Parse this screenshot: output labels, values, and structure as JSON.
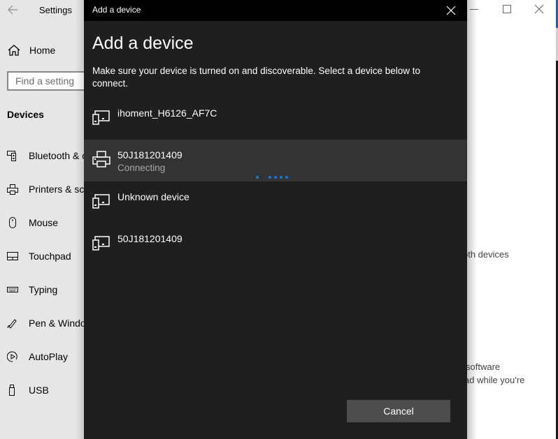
{
  "settings_window": {
    "title": "Settings",
    "home_label": "Home",
    "search_placeholder": "Find a setting",
    "section_heading": "Devices",
    "nav_items": [
      {
        "label": "Bluetooth & other devices",
        "icon": "bluetooth-devices-icon"
      },
      {
        "label": "Printers & scanners",
        "icon": "printer-icon"
      },
      {
        "label": "Mouse",
        "icon": "mouse-icon"
      },
      {
        "label": "Touchpad",
        "icon": "touchpad-icon"
      },
      {
        "label": "Typing",
        "icon": "keyboard-icon"
      },
      {
        "label": "Pen & Windows Ink",
        "icon": "pen-icon"
      },
      {
        "label": "AutoPlay",
        "icon": "autoplay-icon"
      },
      {
        "label": "USB",
        "icon": "usb-icon"
      }
    ],
    "right_pane_fragments": [
      "oth devices",
      "software",
      "ad while you're"
    ],
    "window_controls": [
      "minimize",
      "maximize",
      "close"
    ]
  },
  "dialog": {
    "title": "Add a device",
    "heading": "Add a device",
    "description": "Make sure your device is turned on and discoverable. Select a device below to connect.",
    "devices": [
      {
        "name": "ihoment_H6126_AF7C",
        "status": "",
        "icon": "generic-device-icon",
        "selected": false
      },
      {
        "name": "50J181201409",
        "status": "Connecting",
        "icon": "printer-icon",
        "selected": true
      },
      {
        "name": "Unknown device",
        "status": "",
        "icon": "generic-device-icon",
        "selected": false
      },
      {
        "name": "50J181201409",
        "status": "",
        "icon": "generic-device-icon",
        "selected": false
      }
    ],
    "cancel_label": "Cancel",
    "accent_color": "#1a78d4"
  }
}
